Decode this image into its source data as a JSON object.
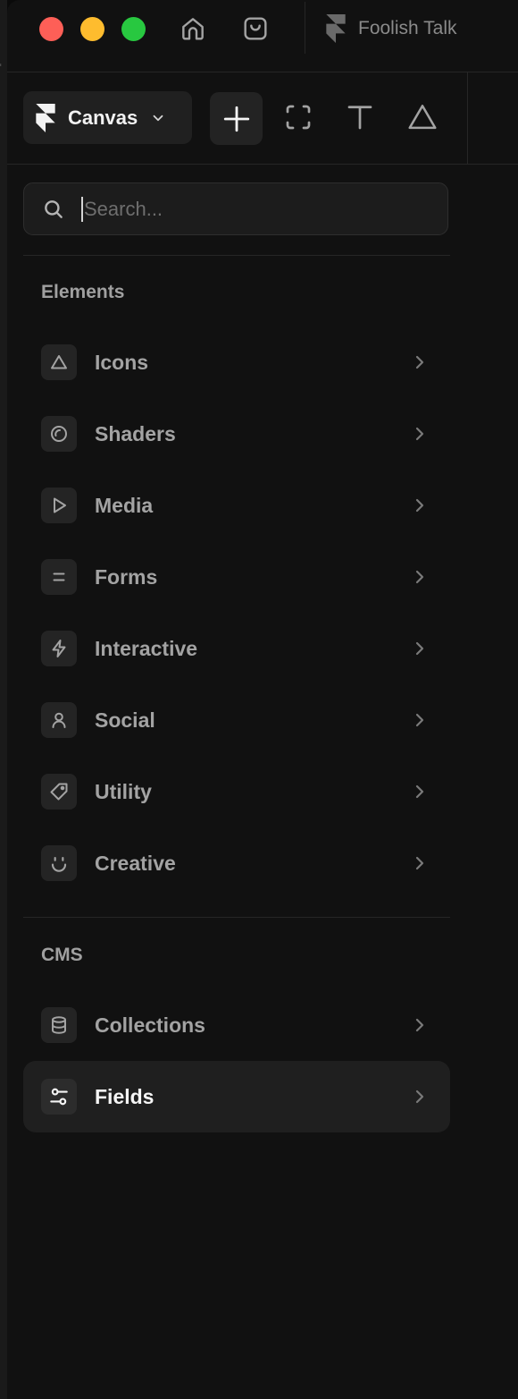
{
  "titlebar": {
    "project_name": "Foolish Talk"
  },
  "toolbar": {
    "canvas_label": "Canvas"
  },
  "search": {
    "placeholder": "Search...",
    "value": ""
  },
  "sections": {
    "elements": {
      "title": "Elements",
      "items": [
        {
          "label": "Icons",
          "icon": "triangle-icon"
        },
        {
          "label": "Shaders",
          "icon": "shader-circle-icon"
        },
        {
          "label": "Media",
          "icon": "play-icon"
        },
        {
          "label": "Forms",
          "icon": "form-lines-icon"
        },
        {
          "label": "Interactive",
          "icon": "bolt-icon"
        },
        {
          "label": "Social",
          "icon": "user-icon"
        },
        {
          "label": "Utility",
          "icon": "tag-icon"
        },
        {
          "label": "Creative",
          "icon": "smile-icon"
        }
      ]
    },
    "cms": {
      "title": "CMS",
      "items": [
        {
          "label": "Collections",
          "icon": "database-icon"
        },
        {
          "label": "Fields",
          "icon": "sliders-icon",
          "active": true
        }
      ]
    }
  },
  "colors": {
    "close": "#fe5f57",
    "minimize": "#febc2e",
    "zoom": "#28c840",
    "background": "#111111",
    "active_row": "#1f1f1f"
  }
}
